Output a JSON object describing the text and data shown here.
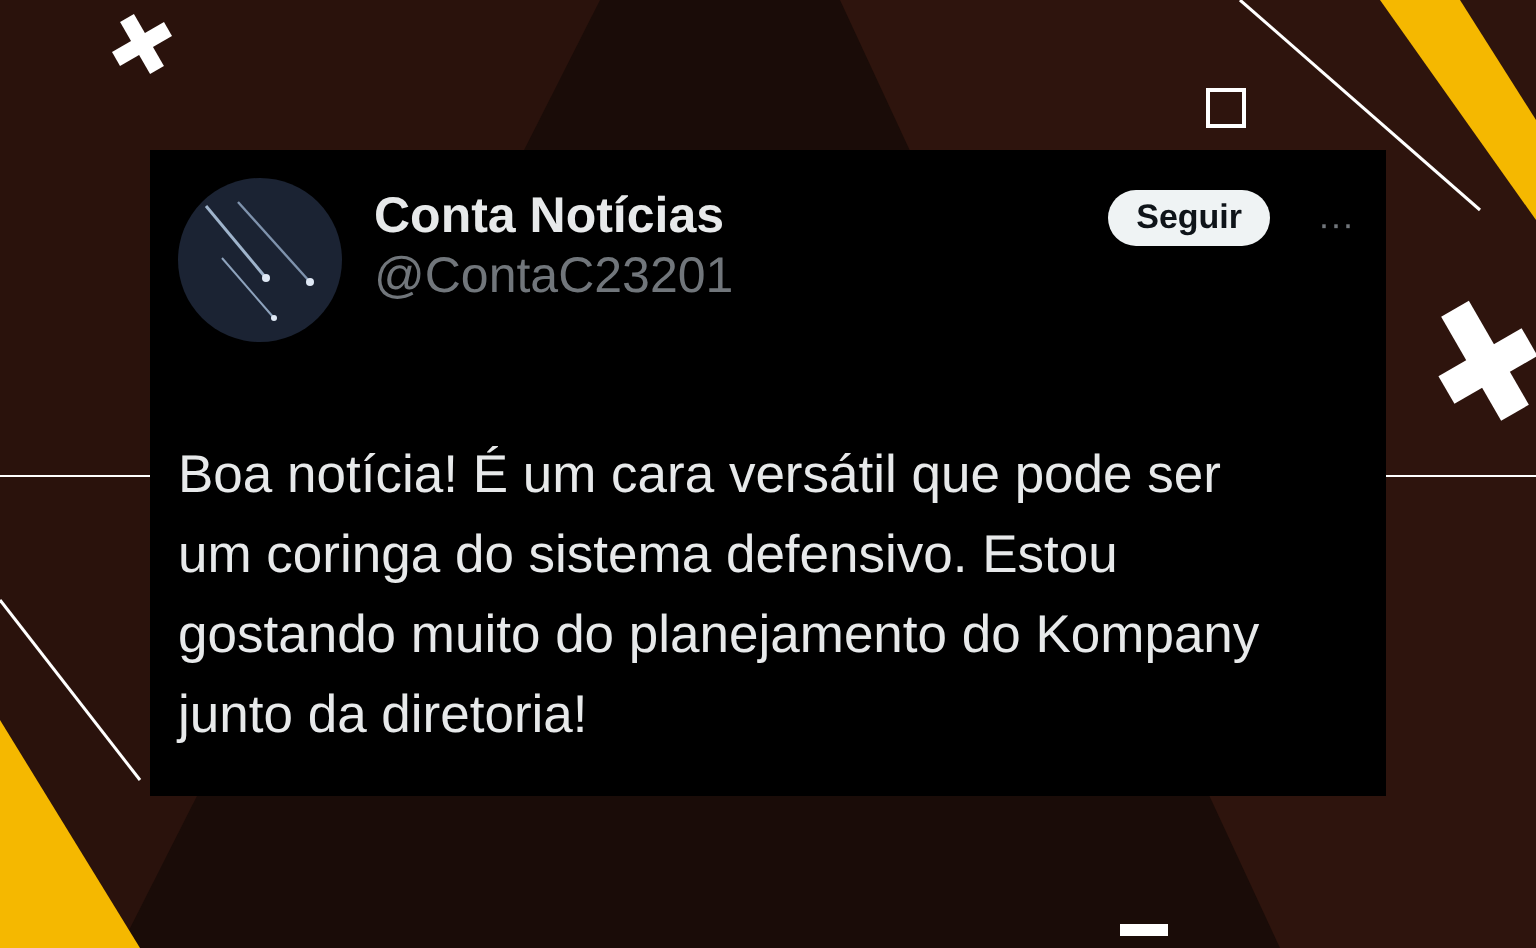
{
  "post": {
    "author_name": "Conta Notícias",
    "handle": "@ContaC23201",
    "follow_button": "Seguir",
    "more_menu": "···",
    "text": "Boa notícia! É um cara versátil que pode ser um coringa do sistema defensivo. Estou gostando muito do planejamento do Kompany junto da diretoria!"
  }
}
